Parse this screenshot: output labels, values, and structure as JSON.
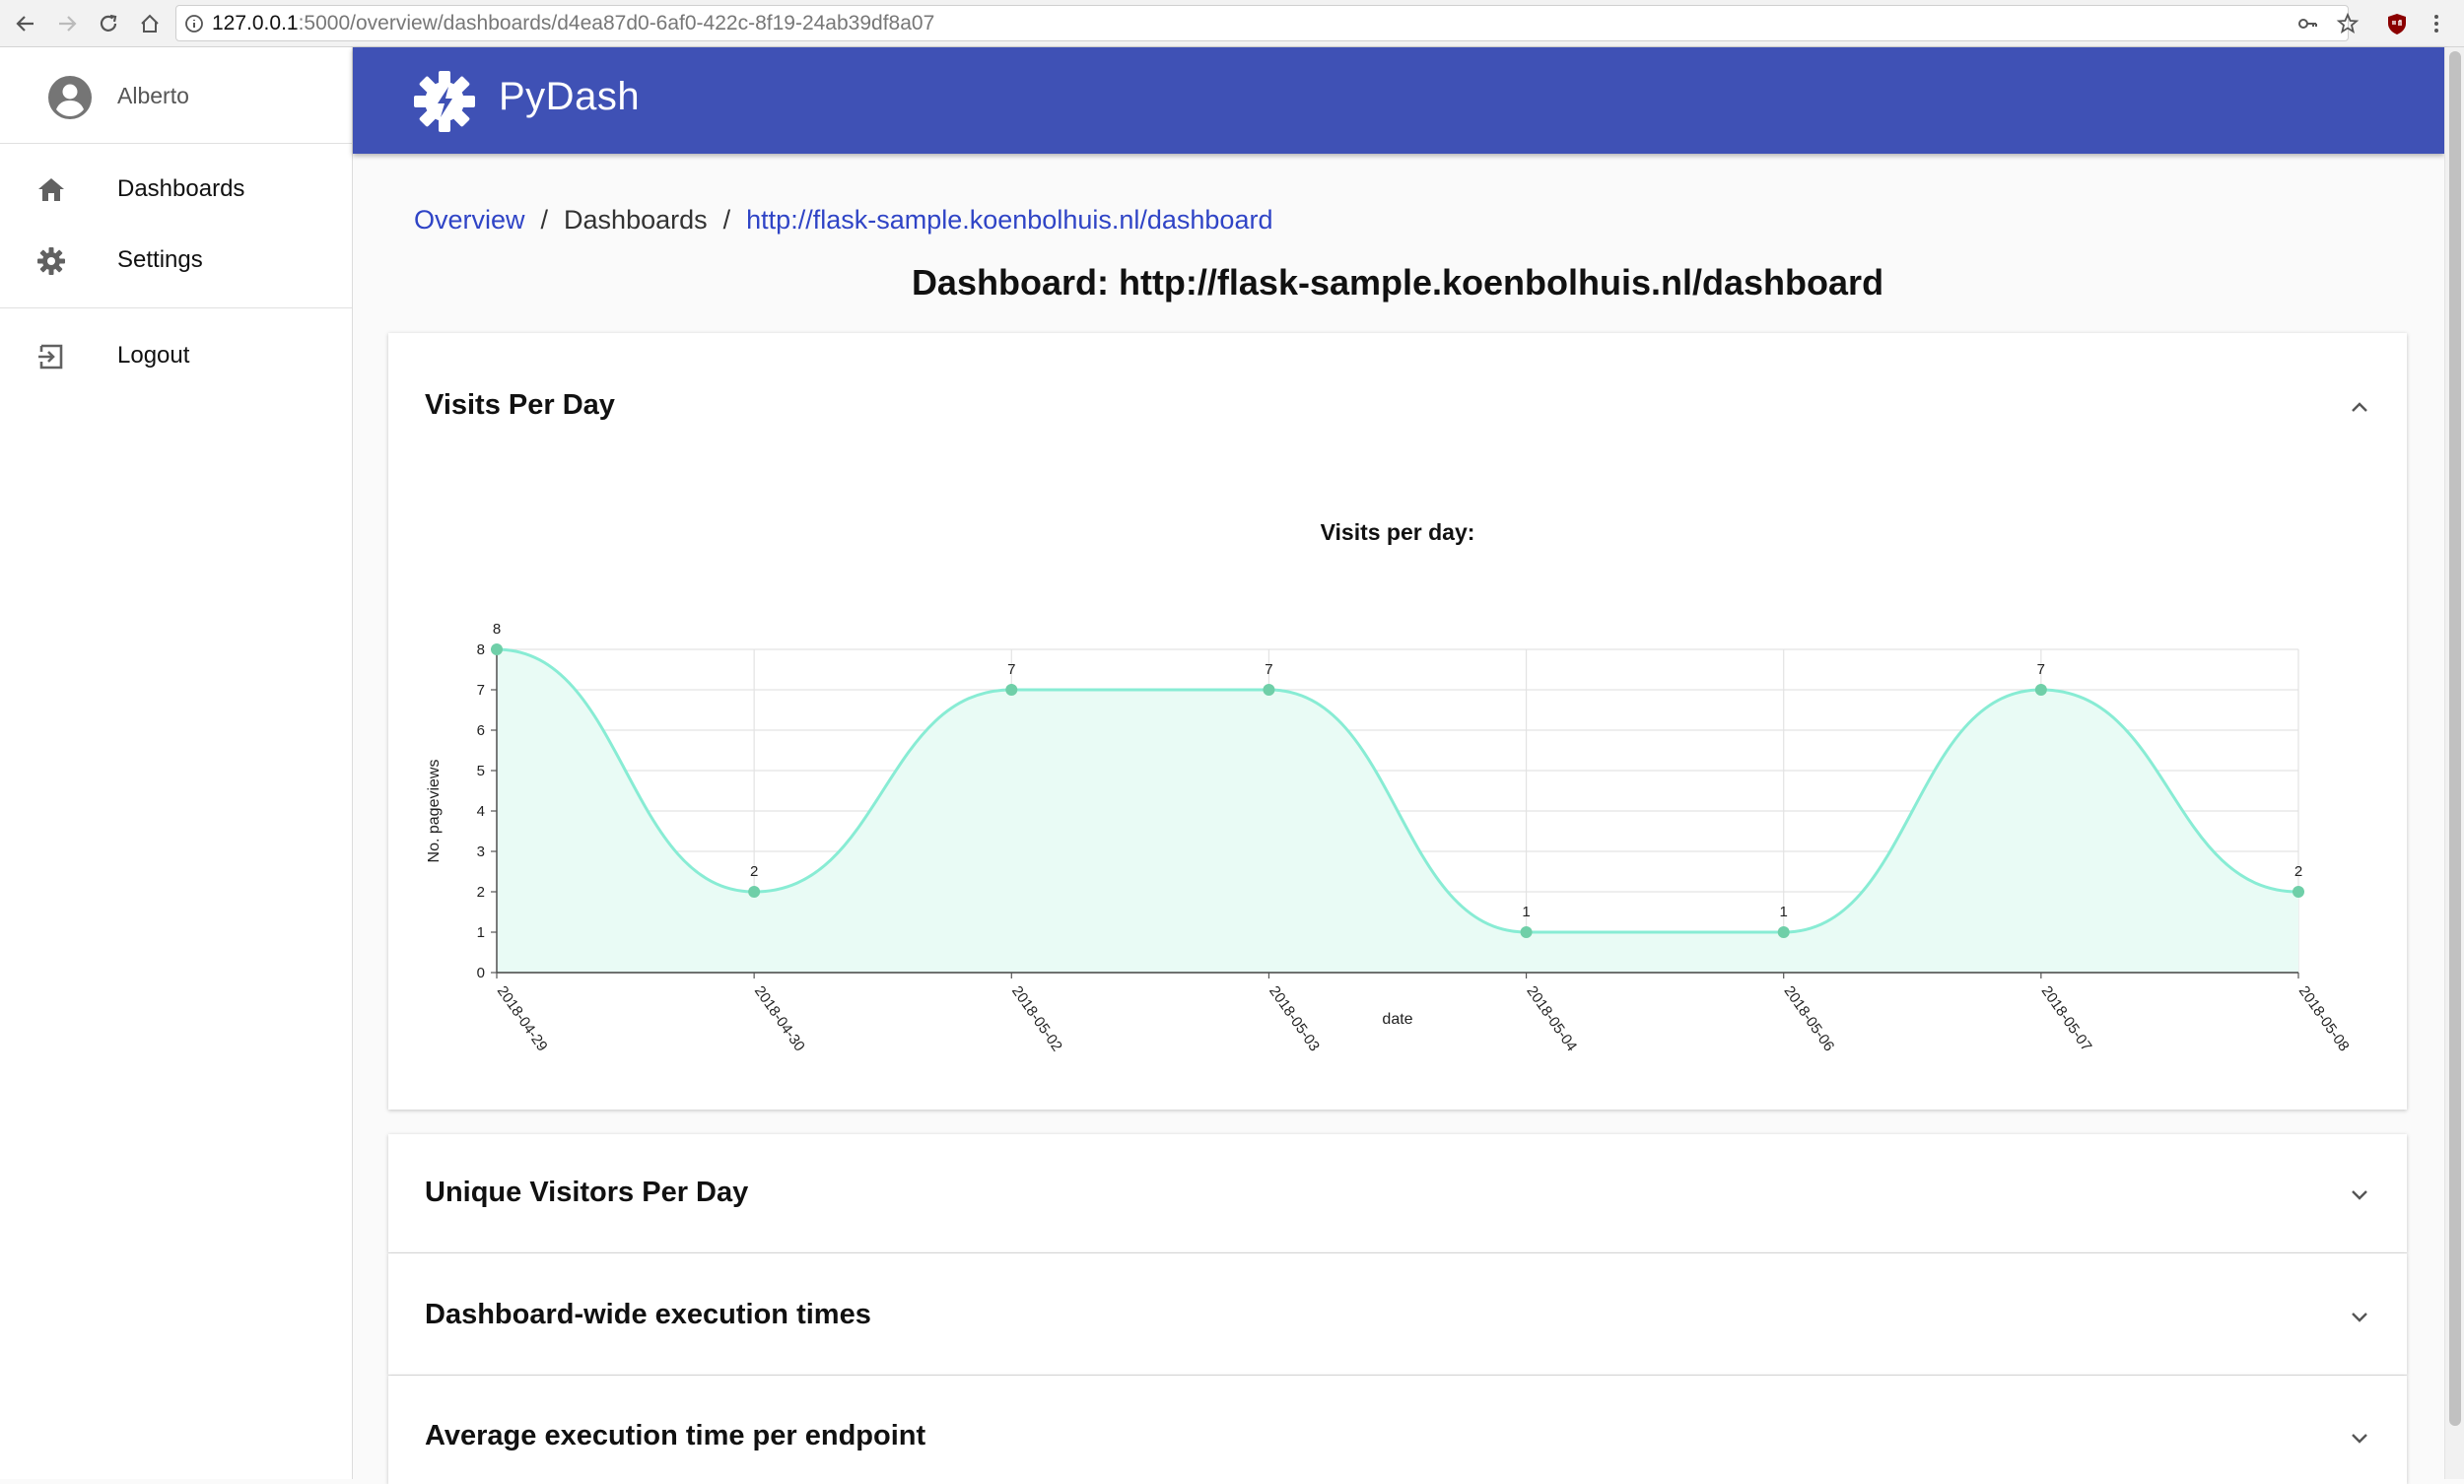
{
  "browser": {
    "url_host": "127.0.0.1",
    "url_rest": ":5000/overview/dashboards/d4ea87d0-6af0-422c-8f19-24ab39df8a07"
  },
  "sidebar": {
    "user_name": "Alberto",
    "items": [
      {
        "label": "Dashboards",
        "icon": "home-icon"
      },
      {
        "label": "Settings",
        "icon": "gear-icon"
      },
      {
        "label": "Logout",
        "icon": "logout-icon"
      }
    ]
  },
  "appbar": {
    "title": "PyDash"
  },
  "breadcrumb": {
    "overview": "Overview",
    "sep": "/",
    "dashboards": "Dashboards",
    "current": "http://flask-sample.koenbolhuis.nl/dashboard"
  },
  "page_title": "Dashboard: http://flask-sample.koenbolhuis.nl/dashboard",
  "panels": [
    {
      "title": "Visits Per Day",
      "expanded": true
    },
    {
      "title": "Unique Visitors Per Day",
      "expanded": false
    },
    {
      "title": "Dashboard-wide execution times",
      "expanded": false
    },
    {
      "title": "Average execution time per endpoint",
      "expanded": false
    }
  ],
  "colors": {
    "accent": "#3f51b5",
    "line": "#88ecd4",
    "point": "#6fcfa8",
    "area": "#e9fbf5"
  },
  "chart_data": {
    "type": "area",
    "title": "Visits per day:",
    "xlabel": "date",
    "ylabel": "No. pageviews",
    "categories": [
      "2018-04-29",
      "2018-04-30",
      "2018-05-02",
      "2018-05-03",
      "2018-05-04",
      "2018-05-06",
      "2018-05-07",
      "2018-05-08"
    ],
    "values": [
      8,
      2,
      7,
      7,
      1,
      1,
      7,
      2
    ],
    "ylim": [
      0,
      8
    ],
    "yticks": [
      "0",
      "1",
      "2",
      "3",
      "4",
      "5",
      "6",
      "7",
      "8"
    ],
    "data_labels": [
      "8",
      "2",
      "7",
      "7",
      "1",
      "1",
      "7",
      "2"
    ],
    "grid": true,
    "legend": "none"
  }
}
